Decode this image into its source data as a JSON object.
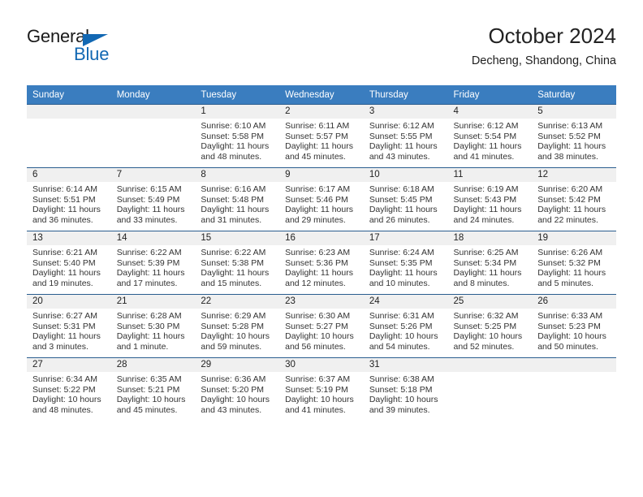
{
  "brand": {
    "name_part1": "General",
    "name_part2": "Blue",
    "accent_color": "#1268b3"
  },
  "header": {
    "title": "October 2024",
    "subtitle": "Decheng, Shandong, China"
  },
  "calendar": {
    "header_color": "#3a7dbf",
    "weekday_headers": [
      "Sunday",
      "Monday",
      "Tuesday",
      "Wednesday",
      "Thursday",
      "Friday",
      "Saturday"
    ],
    "weeks": [
      [
        {
          "day": "",
          "sunrise": "",
          "sunset": "",
          "daylight": ""
        },
        {
          "day": "",
          "sunrise": "",
          "sunset": "",
          "daylight": ""
        },
        {
          "day": "1",
          "sunrise": "Sunrise: 6:10 AM",
          "sunset": "Sunset: 5:58 PM",
          "daylight": "Daylight: 11 hours and 48 minutes."
        },
        {
          "day": "2",
          "sunrise": "Sunrise: 6:11 AM",
          "sunset": "Sunset: 5:57 PM",
          "daylight": "Daylight: 11 hours and 45 minutes."
        },
        {
          "day": "3",
          "sunrise": "Sunrise: 6:12 AM",
          "sunset": "Sunset: 5:55 PM",
          "daylight": "Daylight: 11 hours and 43 minutes."
        },
        {
          "day": "4",
          "sunrise": "Sunrise: 6:12 AM",
          "sunset": "Sunset: 5:54 PM",
          "daylight": "Daylight: 11 hours and 41 minutes."
        },
        {
          "day": "5",
          "sunrise": "Sunrise: 6:13 AM",
          "sunset": "Sunset: 5:52 PM",
          "daylight": "Daylight: 11 hours and 38 minutes."
        }
      ],
      [
        {
          "day": "6",
          "sunrise": "Sunrise: 6:14 AM",
          "sunset": "Sunset: 5:51 PM",
          "daylight": "Daylight: 11 hours and 36 minutes."
        },
        {
          "day": "7",
          "sunrise": "Sunrise: 6:15 AM",
          "sunset": "Sunset: 5:49 PM",
          "daylight": "Daylight: 11 hours and 33 minutes."
        },
        {
          "day": "8",
          "sunrise": "Sunrise: 6:16 AM",
          "sunset": "Sunset: 5:48 PM",
          "daylight": "Daylight: 11 hours and 31 minutes."
        },
        {
          "day": "9",
          "sunrise": "Sunrise: 6:17 AM",
          "sunset": "Sunset: 5:46 PM",
          "daylight": "Daylight: 11 hours and 29 minutes."
        },
        {
          "day": "10",
          "sunrise": "Sunrise: 6:18 AM",
          "sunset": "Sunset: 5:45 PM",
          "daylight": "Daylight: 11 hours and 26 minutes."
        },
        {
          "day": "11",
          "sunrise": "Sunrise: 6:19 AM",
          "sunset": "Sunset: 5:43 PM",
          "daylight": "Daylight: 11 hours and 24 minutes."
        },
        {
          "day": "12",
          "sunrise": "Sunrise: 6:20 AM",
          "sunset": "Sunset: 5:42 PM",
          "daylight": "Daylight: 11 hours and 22 minutes."
        }
      ],
      [
        {
          "day": "13",
          "sunrise": "Sunrise: 6:21 AM",
          "sunset": "Sunset: 5:40 PM",
          "daylight": "Daylight: 11 hours and 19 minutes."
        },
        {
          "day": "14",
          "sunrise": "Sunrise: 6:22 AM",
          "sunset": "Sunset: 5:39 PM",
          "daylight": "Daylight: 11 hours and 17 minutes."
        },
        {
          "day": "15",
          "sunrise": "Sunrise: 6:22 AM",
          "sunset": "Sunset: 5:38 PM",
          "daylight": "Daylight: 11 hours and 15 minutes."
        },
        {
          "day": "16",
          "sunrise": "Sunrise: 6:23 AM",
          "sunset": "Sunset: 5:36 PM",
          "daylight": "Daylight: 11 hours and 12 minutes."
        },
        {
          "day": "17",
          "sunrise": "Sunrise: 6:24 AM",
          "sunset": "Sunset: 5:35 PM",
          "daylight": "Daylight: 11 hours and 10 minutes."
        },
        {
          "day": "18",
          "sunrise": "Sunrise: 6:25 AM",
          "sunset": "Sunset: 5:34 PM",
          "daylight": "Daylight: 11 hours and 8 minutes."
        },
        {
          "day": "19",
          "sunrise": "Sunrise: 6:26 AM",
          "sunset": "Sunset: 5:32 PM",
          "daylight": "Daylight: 11 hours and 5 minutes."
        }
      ],
      [
        {
          "day": "20",
          "sunrise": "Sunrise: 6:27 AM",
          "sunset": "Sunset: 5:31 PM",
          "daylight": "Daylight: 11 hours and 3 minutes."
        },
        {
          "day": "21",
          "sunrise": "Sunrise: 6:28 AM",
          "sunset": "Sunset: 5:30 PM",
          "daylight": "Daylight: 11 hours and 1 minute."
        },
        {
          "day": "22",
          "sunrise": "Sunrise: 6:29 AM",
          "sunset": "Sunset: 5:28 PM",
          "daylight": "Daylight: 10 hours and 59 minutes."
        },
        {
          "day": "23",
          "sunrise": "Sunrise: 6:30 AM",
          "sunset": "Sunset: 5:27 PM",
          "daylight": "Daylight: 10 hours and 56 minutes."
        },
        {
          "day": "24",
          "sunrise": "Sunrise: 6:31 AM",
          "sunset": "Sunset: 5:26 PM",
          "daylight": "Daylight: 10 hours and 54 minutes."
        },
        {
          "day": "25",
          "sunrise": "Sunrise: 6:32 AM",
          "sunset": "Sunset: 5:25 PM",
          "daylight": "Daylight: 10 hours and 52 minutes."
        },
        {
          "day": "26",
          "sunrise": "Sunrise: 6:33 AM",
          "sunset": "Sunset: 5:23 PM",
          "daylight": "Daylight: 10 hours and 50 minutes."
        }
      ],
      [
        {
          "day": "27",
          "sunrise": "Sunrise: 6:34 AM",
          "sunset": "Sunset: 5:22 PM",
          "daylight": "Daylight: 10 hours and 48 minutes."
        },
        {
          "day": "28",
          "sunrise": "Sunrise: 6:35 AM",
          "sunset": "Sunset: 5:21 PM",
          "daylight": "Daylight: 10 hours and 45 minutes."
        },
        {
          "day": "29",
          "sunrise": "Sunrise: 6:36 AM",
          "sunset": "Sunset: 5:20 PM",
          "daylight": "Daylight: 10 hours and 43 minutes."
        },
        {
          "day": "30",
          "sunrise": "Sunrise: 6:37 AM",
          "sunset": "Sunset: 5:19 PM",
          "daylight": "Daylight: 10 hours and 41 minutes."
        },
        {
          "day": "31",
          "sunrise": "Sunrise: 6:38 AM",
          "sunset": "Sunset: 5:18 PM",
          "daylight": "Daylight: 10 hours and 39 minutes."
        },
        {
          "day": "",
          "sunrise": "",
          "sunset": "",
          "daylight": ""
        },
        {
          "day": "",
          "sunrise": "",
          "sunset": "",
          "daylight": ""
        }
      ]
    ]
  }
}
